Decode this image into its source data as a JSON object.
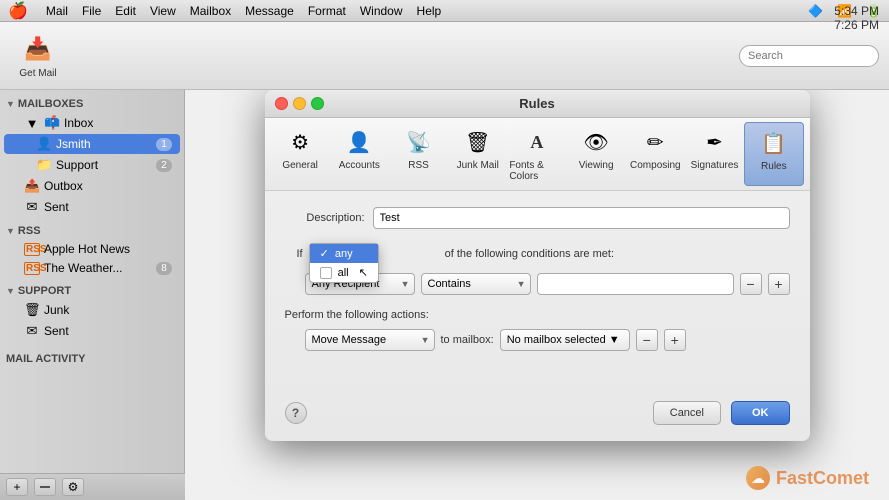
{
  "menubar": {
    "apple": "⌘",
    "app_name": "Mail",
    "menus": [
      "File",
      "Edit",
      "View",
      "Mailbox",
      "Message",
      "Format",
      "Window",
      "Help"
    ],
    "battery_icon": "🔋",
    "wifi_icon": "📶"
  },
  "toolbar": {
    "get_mail_label": "Get Mail",
    "search_placeholder": "Search",
    "time1": "5:34 PM",
    "time2": "7:26 PM"
  },
  "sidebar": {
    "mailboxes_header": "MAILBOXES",
    "inbox_label": "Inbox",
    "jsmith_label": "Jsmith",
    "jsmith_badge": "1",
    "support_label": "Support",
    "support_badge": "2",
    "outbox_label": "Outbox",
    "sent_label": "Sent",
    "rss_header": "RSS",
    "apple_hot_news_label": "Apple Hot News",
    "weather_label": "The Weather...",
    "weather_badge": "8",
    "support_section_header": "SUPPORT",
    "junk_label": "Junk",
    "support_sent_label": "Sent",
    "mail_activity_header": "MAIL ACTIVITY"
  },
  "dialog": {
    "title": "Rules",
    "toolbar_items": [
      {
        "label": "General",
        "icon": "⚙"
      },
      {
        "label": "Accounts",
        "icon": "👤"
      },
      {
        "label": "RSS",
        "icon": "📡"
      },
      {
        "label": "Junk Mail",
        "icon": "🗑"
      },
      {
        "label": "Fonts & Colors",
        "icon": "A"
      },
      {
        "label": "Viewing",
        "icon": "👁"
      },
      {
        "label": "Composing",
        "icon": "✏"
      },
      {
        "label": "Signatures",
        "icon": "✒"
      },
      {
        "label": "Rules",
        "icon": "📋"
      }
    ],
    "description_label": "Description:",
    "description_value": "Test",
    "condition_prefix": "If",
    "any_label": "any",
    "all_label": "all",
    "condition_suffix": "of the following conditions are met:",
    "dropdown_options": [
      {
        "label": "any",
        "selected": true
      },
      {
        "label": "all",
        "selected": false
      }
    ],
    "condition_type": "Any Recipient",
    "condition_op": "Contains",
    "actions_label": "Perform the following actions:",
    "action_type": "Move Message",
    "to_mailbox_label": "to mailbox:",
    "no_mailbox_label": "No mailbox selected",
    "help_label": "?",
    "cancel_label": "Cancel",
    "ok_label": "OK",
    "cursor_label": "↖"
  },
  "watermark": {
    "logo_symbol": "☁",
    "brand": "Fast",
    "brand_accent": "Comet"
  }
}
